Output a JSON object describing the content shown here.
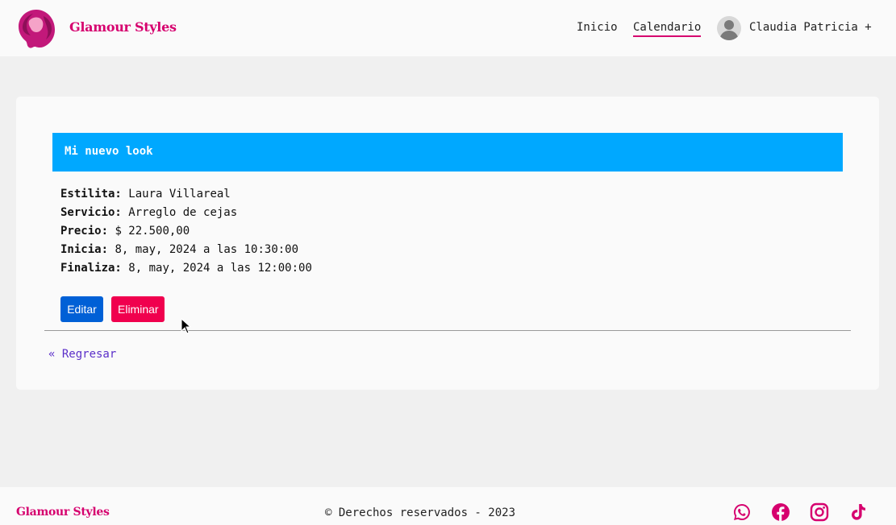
{
  "header": {
    "brand": "Glamour Styles",
    "nav": {
      "home": "Inicio",
      "calendar": "Calendario"
    },
    "user": {
      "name": "Claudia Patricia +",
      "avatar_icon": "user-avatar-icon"
    },
    "logo_icon": "woman-hair-logo-icon"
  },
  "appointment": {
    "title": "Mi nuevo look",
    "labels": {
      "stylist": "Estilita:",
      "service": "Servicio:",
      "price": "Precio:",
      "start": "Inicia:",
      "end": "Finaliza:"
    },
    "values": {
      "stylist": "Laura Villareal",
      "service": "Arreglo de cejas",
      "price": "$ 22.500,00",
      "start": "8, may, 2024 a las 10:30:00",
      "end": "8, may, 2024 a las 12:00:00"
    },
    "buttons": {
      "edit": "Editar",
      "delete": "Eliminar"
    },
    "back_link": "« Regresar"
  },
  "footer": {
    "brand": "Glamour Styles",
    "copyright": "© Derechos reservados - 2023",
    "social_icons": [
      "whatsapp-icon",
      "facebook-icon",
      "instagram-icon",
      "tiktok-icon"
    ]
  },
  "colors": {
    "brand_pink": "#d6006e",
    "title_bar": "#00a8ff",
    "edit_button": "#0060d6",
    "delete_button": "#f0004e",
    "link": "#5b2fc9"
  }
}
